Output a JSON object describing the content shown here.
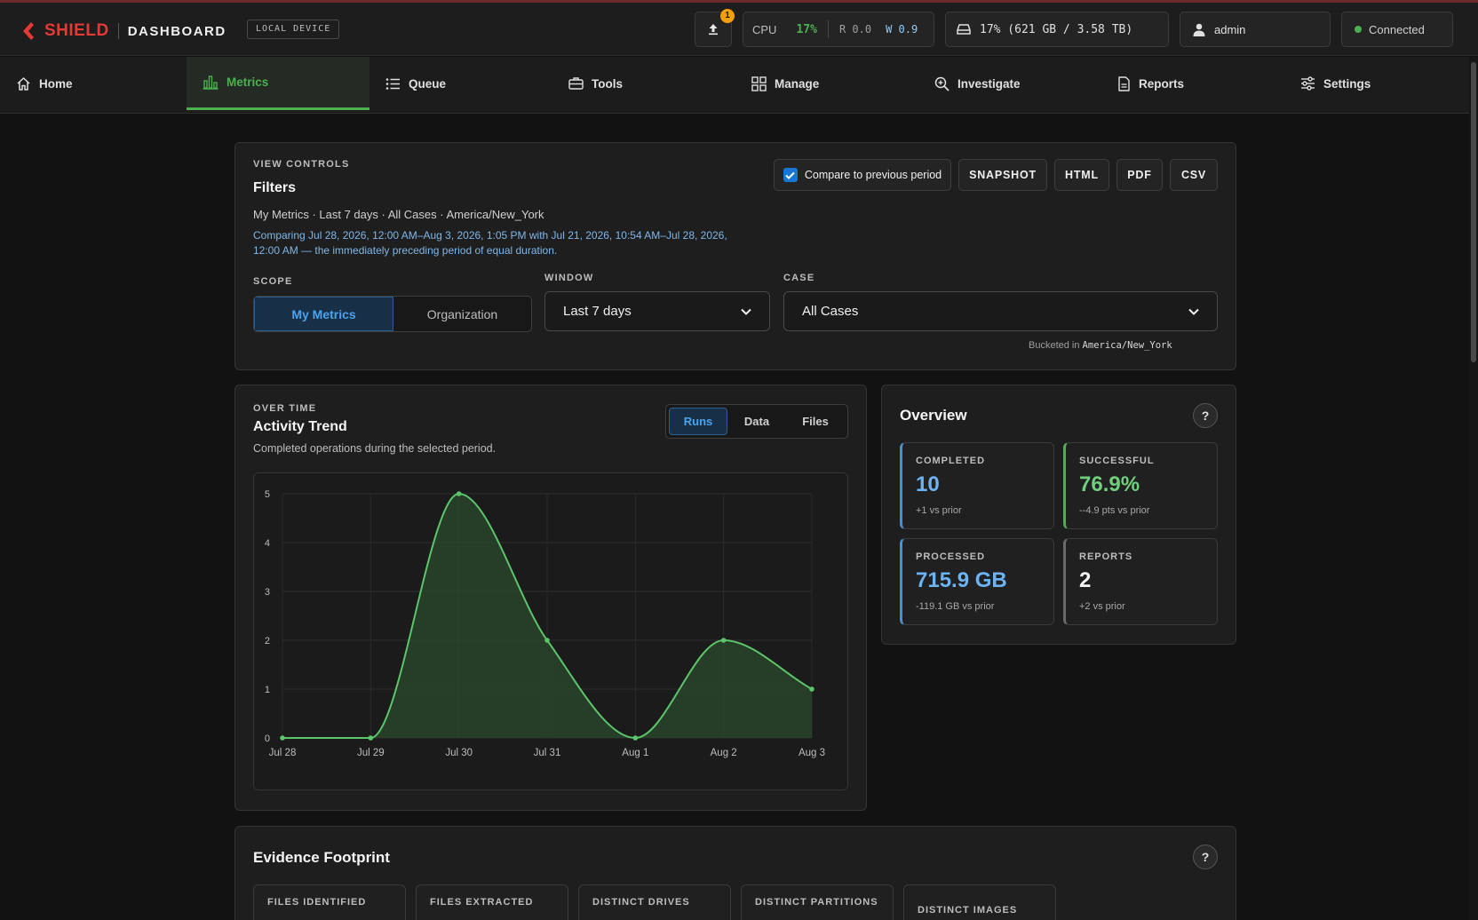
{
  "app": {
    "brand": "SHIELD",
    "section": "DASHBOARD",
    "device_badge": "LOCAL DEVICE"
  },
  "header": {
    "upload_count": "1",
    "cpu": {
      "label": "CPU",
      "value": "17%",
      "read": "R 0.0",
      "write": "W 0.9"
    },
    "disk": "17% (621 GB / 3.58 TB)",
    "user": "admin",
    "connection": "Connected",
    "colors": {
      "brand_red": "#e53935",
      "accent_green": "#4caf50",
      "accent_blue": "#4aa3f0"
    }
  },
  "nav": {
    "items": [
      {
        "label": "Home",
        "icon": "home-icon"
      },
      {
        "label": "Metrics",
        "icon": "bar-chart-icon",
        "active": true
      },
      {
        "label": "Queue",
        "icon": "list-icon"
      },
      {
        "label": "Tools",
        "icon": "toolbox-icon"
      },
      {
        "label": "Manage",
        "icon": "grid-icon"
      },
      {
        "label": "Investigate",
        "icon": "zoom-icon"
      },
      {
        "label": "Reports",
        "icon": "document-icon"
      },
      {
        "label": "Settings",
        "icon": "sliders-icon"
      }
    ]
  },
  "view_controls": {
    "overline": "VIEW CONTROLS",
    "title": "Filters",
    "summary": "My Metrics · Last 7 days · All Cases · America/New_York",
    "comparison_line1": "Comparing Jul 28, 2026, 12:00 AM–Aug 3, 2026, 1:05 PM with Jul 21, 2026, 10:54 AM–Jul 28, 2026,",
    "comparison_line2": "12:00 AM — the immediately preceding period of equal duration.",
    "compare_label": "Compare to previous period",
    "compare_checked": true,
    "buttons": {
      "snapshot": "SNAPSHOT",
      "html": "HTML",
      "pdf": "PDF",
      "csv": "CSV"
    },
    "scope_label": "SCOPE",
    "scope_options": [
      "My Metrics",
      "Organization"
    ],
    "window_label": "WINDOW",
    "window_value": "Last 7 days",
    "case_label": "CASE",
    "case_value": "All Cases",
    "bucket_prefix": "Bucketed in",
    "bucket_tz": "America/New_York"
  },
  "activity": {
    "overline": "OVER TIME",
    "title": "Activity Trend",
    "subtitle": "Completed operations during the selected period.",
    "tabs": [
      "Runs",
      "Data",
      "Files"
    ],
    "active_tab": "Runs"
  },
  "chart_data": {
    "type": "area",
    "title": "",
    "xlabel": "",
    "ylabel": "",
    "categories": [
      "Jul 28",
      "Jul 29",
      "Jul 30",
      "Jul 31",
      "Aug 1",
      "Aug 2",
      "Aug 3"
    ],
    "values": [
      0,
      0,
      5,
      2,
      0,
      2,
      1
    ],
    "ylim": [
      0,
      5
    ],
    "yticks": [
      0,
      1,
      2,
      3,
      4,
      5
    ],
    "grid": true,
    "legend": "none",
    "line_color": "#5cc46a",
    "fill_color": "#2b4a2e"
  },
  "overview": {
    "title": "Overview",
    "help": "?",
    "stats": [
      {
        "label": "COMPLETED",
        "value": "10",
        "delta": "+1 vs prior",
        "color": "#6db3f2"
      },
      {
        "label": "SUCCESSFUL",
        "value": "76.9%",
        "delta": "--4.9 pts vs prior",
        "color": "#6fcf7c"
      },
      {
        "label": "PROCESSED",
        "value": "715.9 GB",
        "delta": "-119.1 GB vs prior",
        "color": "#6db3f2"
      },
      {
        "label": "REPORTS",
        "value": "2",
        "delta": "+2 vs prior",
        "color": "#f5f5f5"
      }
    ]
  },
  "evidence": {
    "title": "Evidence Footprint",
    "help": "?",
    "cards": [
      "FILES IDENTIFIED",
      "FILES EXTRACTED",
      "DISTINCT DRIVES",
      "DISTINCT PARTITIONS",
      "DISTINCT IMAGES"
    ]
  }
}
